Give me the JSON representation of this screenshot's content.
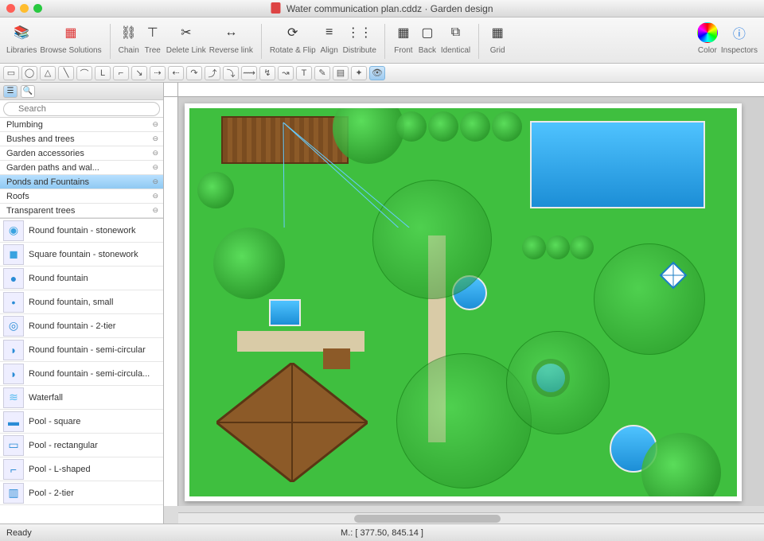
{
  "window": {
    "title": "Water communication plan.cddz · Garden design"
  },
  "toolbar": {
    "groups": [
      {
        "label": "Libraries",
        "icons": [
          "📚"
        ]
      },
      {
        "label": "Browse Solutions",
        "icons": [
          "🟥"
        ]
      },
      {
        "label": "Chain",
        "icons": [
          "🔗"
        ]
      },
      {
        "label": "Tree",
        "icons": [
          "🌳"
        ]
      },
      {
        "label": "Delete Link",
        "icons": [
          "✂"
        ]
      },
      {
        "label": "Reverse link",
        "icons": [
          "↔"
        ]
      },
      {
        "label": "Rotate & Flip",
        "icons": [
          "⟳"
        ]
      },
      {
        "label": "Align",
        "icons": [
          "≡"
        ]
      },
      {
        "label": "Distribute",
        "icons": [
          "⋮⋮"
        ]
      },
      {
        "label": "Front",
        "icons": [
          "▦"
        ]
      },
      {
        "label": "Back",
        "icons": [
          "▢"
        ]
      },
      {
        "label": "Identical",
        "icons": [
          "⧉"
        ]
      },
      {
        "label": "Grid",
        "icons": [
          "▦"
        ]
      },
      {
        "label": "Color",
        "icons": [
          "◉"
        ]
      },
      {
        "label": "Inspectors",
        "icons": [
          "ℹ"
        ]
      }
    ]
  },
  "subtool_icons": [
    "▭",
    "◯",
    "△",
    "╲",
    "⌒",
    "L",
    "⌐",
    "↘",
    "⇢",
    "⇠",
    "↷",
    "⤴",
    "⤵",
    "⟿",
    "↯",
    "↝",
    "T",
    "✎",
    "▤",
    "✦",
    "👁"
  ],
  "sidebar": {
    "search_placeholder": "Search",
    "categories": [
      {
        "label": "Plumbing",
        "active": false
      },
      {
        "label": "Bushes and trees",
        "active": false
      },
      {
        "label": "Garden accessories",
        "active": false
      },
      {
        "label": "Garden paths and wal...",
        "active": false
      },
      {
        "label": "Ponds and Fountains",
        "active": true
      },
      {
        "label": "Roofs",
        "active": false
      },
      {
        "label": "Transparent trees",
        "active": false
      }
    ],
    "shapes": [
      {
        "label": "Round fountain - stonework",
        "icon": "◉",
        "color": "#3aa3e0"
      },
      {
        "label": "Square fountain - stonework",
        "icon": "◼",
        "color": "#3aa3e0"
      },
      {
        "label": "Round fountain",
        "icon": "●",
        "color": "#2a8cd6"
      },
      {
        "label": "Round fountain, small",
        "icon": "•",
        "color": "#2a8cd6"
      },
      {
        "label": "Round fountain - 2-tier",
        "icon": "◎",
        "color": "#2a8cd6"
      },
      {
        "label": "Round fountain - semi-circular",
        "icon": "◗",
        "color": "#2a8cd6"
      },
      {
        "label": "Round fountain - semi-circula...",
        "icon": "◗",
        "color": "#2a8cd6"
      },
      {
        "label": "Waterfall",
        "icon": "≋",
        "color": "#4fb9f0"
      },
      {
        "label": "Pool - square",
        "icon": "▬",
        "color": "#2a8cd6"
      },
      {
        "label": "Pool - rectangular",
        "icon": "▭",
        "color": "#2a8cd6"
      },
      {
        "label": "Pool - L-shaped",
        "icon": "⌐",
        "color": "#2a8cd6"
      },
      {
        "label": "Pool - 2-tier",
        "icon": "▥",
        "color": "#2a8cd6"
      }
    ]
  },
  "status": {
    "ready": "Ready",
    "mouse": "M.: [ 377.50, 845.14 ]"
  }
}
